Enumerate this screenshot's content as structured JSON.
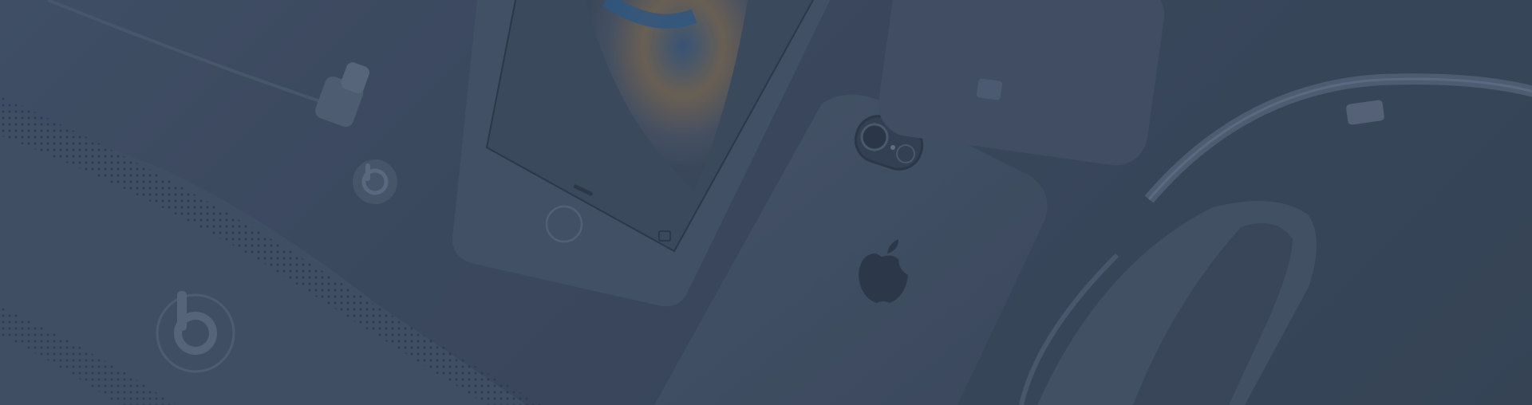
{
  "scene": {
    "overlay_color": "#34435a",
    "objects": [
      "beats-speaker",
      "earbuds",
      "iphone-front",
      "iphone-back",
      "charging-dock",
      "headphones"
    ]
  }
}
